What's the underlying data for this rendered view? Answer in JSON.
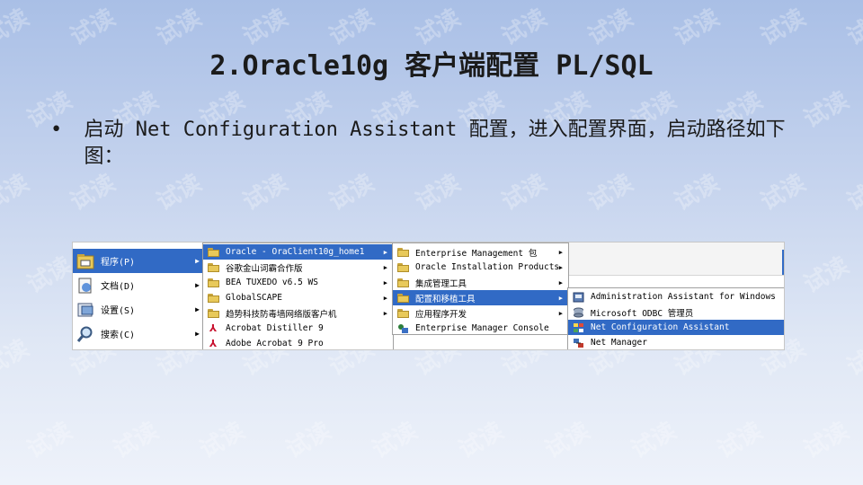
{
  "watermark_text": "试读",
  "slide": {
    "title": "2.Oracle10g 客户端配置 PL/SQL",
    "bullet_marker": "•",
    "bullet_text": "启动 Net Configuration Assistant 配置，进入配置界面，启动路径如下图："
  },
  "start_menu": {
    "items": [
      {
        "label": "程序(P)",
        "icon": "programs-folder-icon",
        "selected": true
      },
      {
        "label": "文档(D)",
        "icon": "documents-icon",
        "selected": false
      },
      {
        "label": "设置(S)",
        "icon": "settings-icon",
        "selected": false
      },
      {
        "label": "搜索(C)",
        "icon": "search-icon",
        "selected": false
      }
    ],
    "arrow": "▶"
  },
  "programs_menu": {
    "items": [
      {
        "label": "Oracle - OraClient10g_home1",
        "icon": "folder-icon",
        "submenu": true,
        "selected": true
      },
      {
        "label": "谷歌金山词霸合作版",
        "icon": "folder-icon",
        "submenu": true,
        "selected": false
      },
      {
        "label": "BEA TUXEDO v6.5 WS",
        "icon": "folder-icon",
        "submenu": true,
        "selected": false
      },
      {
        "label": "GlobalSCAPE",
        "icon": "folder-icon",
        "submenu": true,
        "selected": false
      },
      {
        "label": "趋势科技防毒墙网络版客户机",
        "icon": "folder-icon",
        "submenu": true,
        "selected": false
      },
      {
        "label": "Acrobat Distiller 9",
        "icon": "acrobat-distiller-icon",
        "submenu": false,
        "selected": false
      },
      {
        "label": "Adobe Acrobat 9 Pro",
        "icon": "adobe-acrobat-icon",
        "submenu": false,
        "selected": false
      }
    ]
  },
  "oracle_menu": {
    "items": [
      {
        "label": "Enterprise Management 包",
        "icon": "folder-icon",
        "submenu": true,
        "selected": false
      },
      {
        "label": "Oracle Installation Products",
        "icon": "folder-icon",
        "submenu": true,
        "selected": false
      },
      {
        "label": "集成管理工具",
        "icon": "folder-icon",
        "submenu": true,
        "selected": false
      },
      {
        "label": "配置和移植工具",
        "icon": "folder-icon",
        "submenu": true,
        "selected": true
      },
      {
        "label": "应用程序开发",
        "icon": "folder-icon",
        "submenu": true,
        "selected": false
      },
      {
        "label": "Enterprise Manager Console",
        "icon": "em-console-icon",
        "submenu": false,
        "selected": false
      }
    ]
  },
  "config_menu": {
    "items": [
      {
        "label": "Administration Assistant for Windows",
        "icon": "admin-assistant-icon",
        "selected": false
      },
      {
        "label": "Microsoft ODBC 管理员",
        "icon": "odbc-icon",
        "selected": false
      },
      {
        "label": "Net Configuration Assistant",
        "icon": "net-config-assistant-icon",
        "selected": true
      },
      {
        "label": "Net Manager",
        "icon": "net-manager-icon",
        "selected": false
      }
    ]
  },
  "colors": {
    "menu_highlight": "#316ac5",
    "menu_background": "#ffffff",
    "slide_bg_top": "#a9bfe6",
    "slide_bg_bottom": "#eef2fa"
  }
}
